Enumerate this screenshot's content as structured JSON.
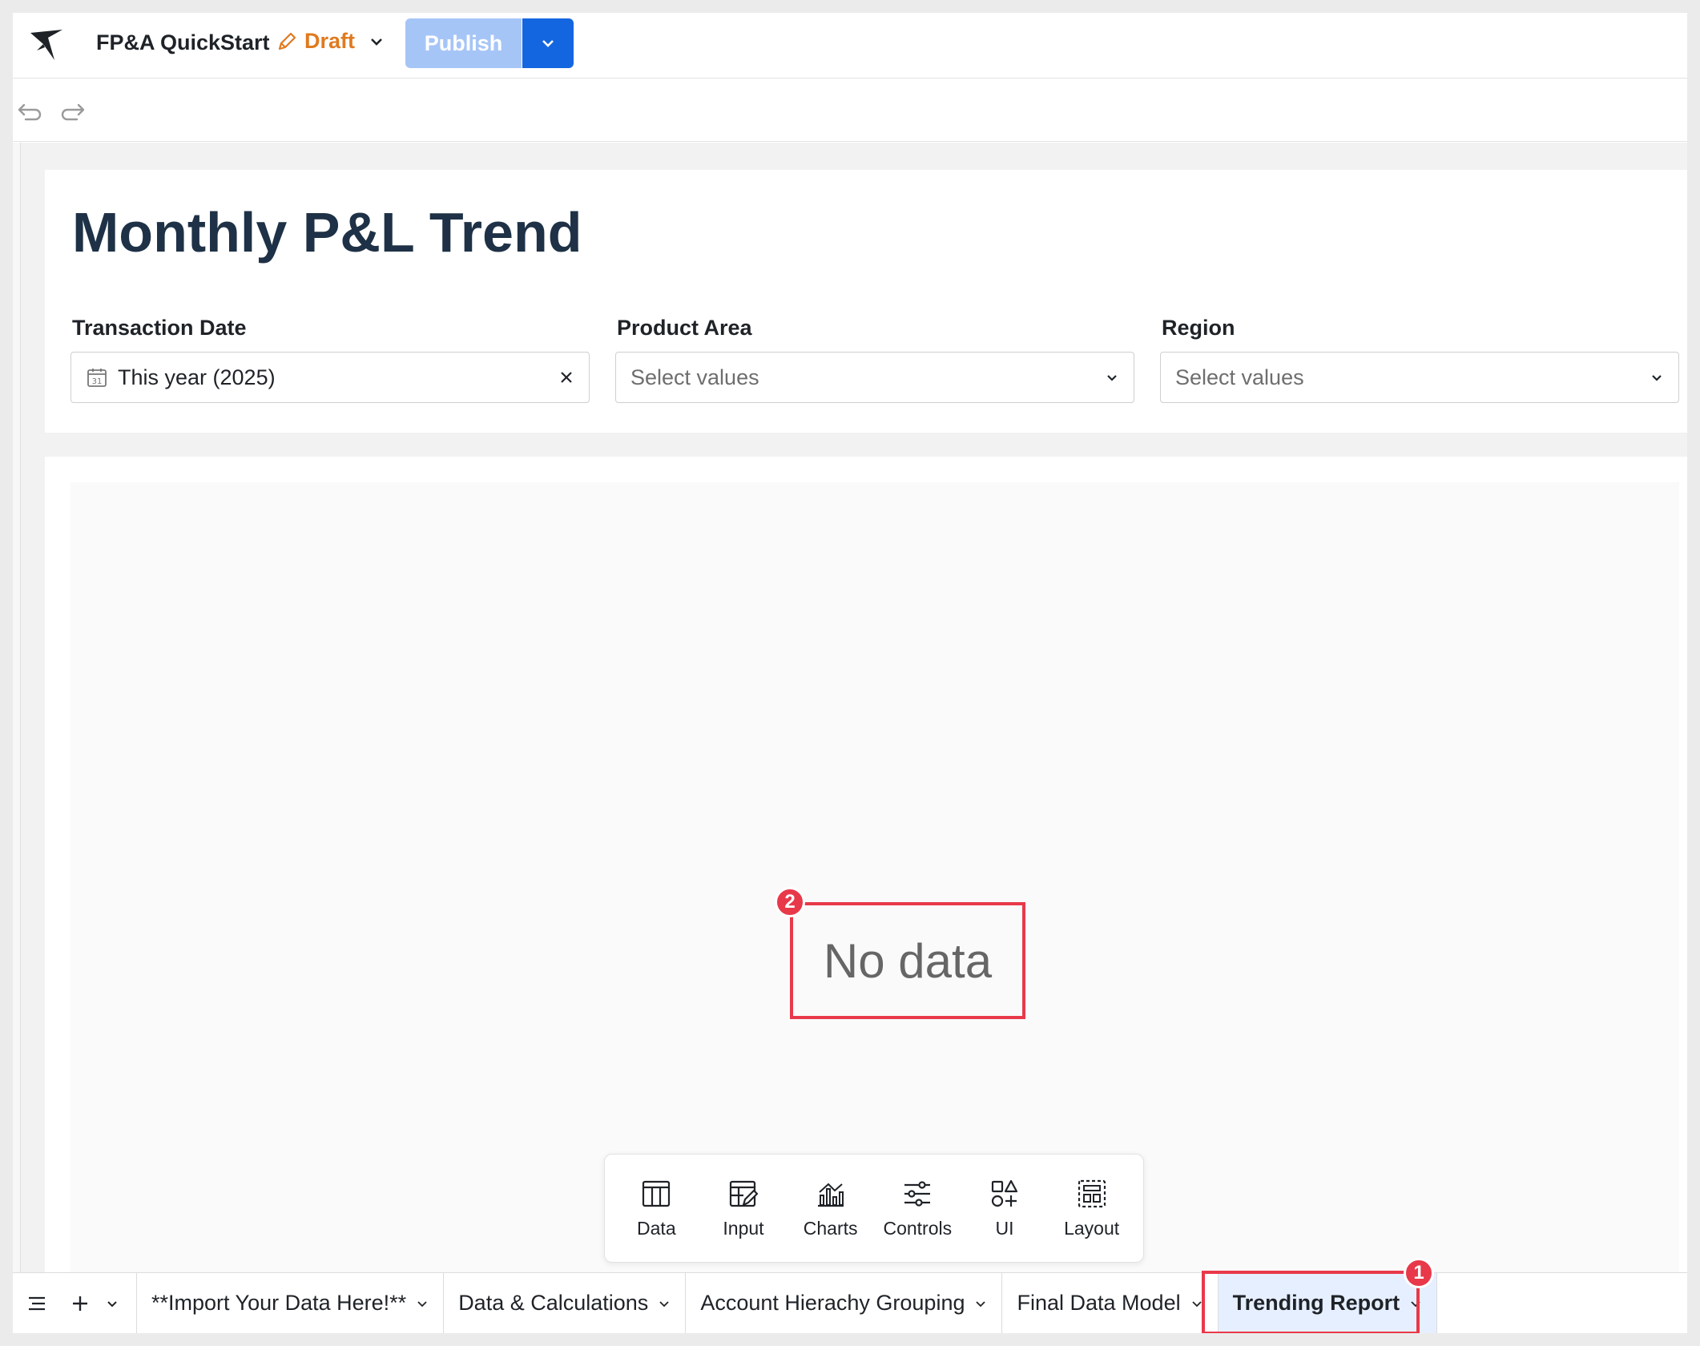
{
  "app": {
    "title": "FP&A QuickStart",
    "status": "Draft",
    "publish_label": "Publish"
  },
  "page": {
    "title": "Monthly P&L Trend"
  },
  "filters": [
    {
      "label": "Transaction Date",
      "value": "This year (2025)"
    },
    {
      "label": "Product Area",
      "placeholder": "Select values"
    },
    {
      "label": "Region",
      "placeholder": "Select values"
    }
  ],
  "chart": {
    "empty_text": "No data"
  },
  "badges": {
    "tab": "1",
    "nodata": "2"
  },
  "toolbar": {
    "items": [
      {
        "label": "Data",
        "icon": "table-icon"
      },
      {
        "label": "Input",
        "icon": "input-table-icon"
      },
      {
        "label": "Charts",
        "icon": "chart-icon"
      },
      {
        "label": "Controls",
        "icon": "sliders-icon"
      },
      {
        "label": "UI",
        "icon": "shapes-icon"
      },
      {
        "label": "Layout",
        "icon": "layout-icon"
      }
    ]
  },
  "tabs": [
    {
      "label": "**Import Your Data Here!**"
    },
    {
      "label": "Data & Calculations"
    },
    {
      "label": "Account Hierachy Grouping"
    },
    {
      "label": "Final Data Model"
    },
    {
      "label": "Trending Report",
      "active": true
    }
  ],
  "colors": {
    "accent": "#1466e0",
    "publish_disabled": "#a6c5f7",
    "draft": "#e07a1f",
    "annotation": "#e8394a",
    "title": "#1e3146"
  }
}
